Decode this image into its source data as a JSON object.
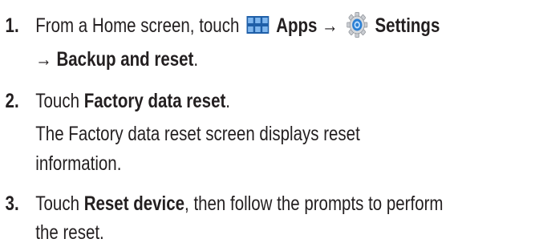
{
  "steps": [
    {
      "number": "1.",
      "line1": {
        "prefix": "From a Home screen, touch",
        "apps_label": "Apps →",
        "settings_label": "Settings"
      },
      "line2": {
        "arrow": "→",
        "backup_label": "Backup and reset",
        "end": "."
      }
    },
    {
      "number": "2.",
      "prefix": "Touch",
      "bold": "Factory data reset",
      "end": ".",
      "description_line1": "The Factory data reset screen displays reset",
      "description_line2": "information."
    },
    {
      "number": "3.",
      "prefix": "Touch",
      "bold": "Reset device",
      "suffix": ", then follow the prompts to perform",
      "line2": "the reset."
    }
  ],
  "icons": {
    "apps": "apps-grid-icon",
    "settings": "gear-icon"
  },
  "colors": {
    "text": "#231f20",
    "apps_icon": "#1f5fa8",
    "settings_icon": "#2a7fd4"
  }
}
